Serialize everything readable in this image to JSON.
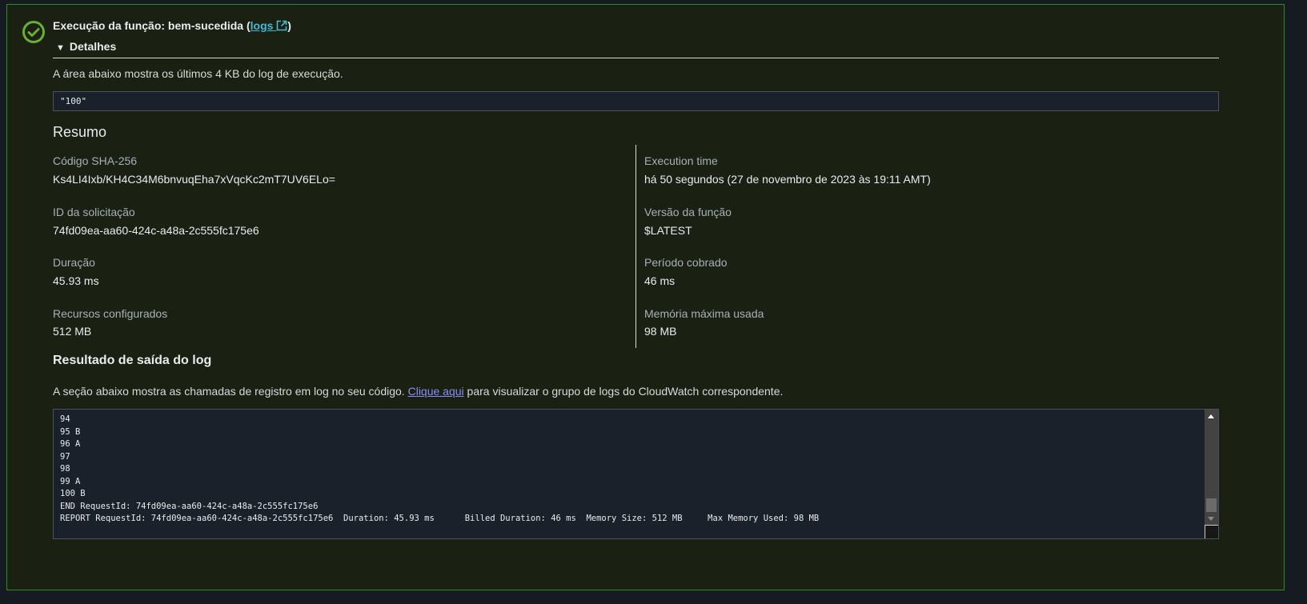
{
  "status": {
    "title_prefix": "Execução da função: bem-sucedida (",
    "logs_link": "logs",
    "title_suffix": ")",
    "color": "#6aaf35"
  },
  "details": {
    "toggle_label": "Detalhes",
    "description": "A área abaixo mostra os últimos 4 KB do log de execução.",
    "output_value": "\"100\""
  },
  "summary": {
    "heading": "Resumo",
    "left": [
      {
        "label": "Código SHA-256",
        "value": "Ks4LI4Ixb/KH4C34M6bnvuqEha7xVqcKc2mT7UV6ELo="
      },
      {
        "label": "ID da solicitação",
        "value": "74fd09ea-aa60-424c-a48a-2c555fc175e6"
      },
      {
        "label": "Duração",
        "value": "45.93 ms"
      },
      {
        "label": "Recursos configurados",
        "value": "512 MB"
      }
    ],
    "right": [
      {
        "label": "Execution time",
        "value": "há 50 segundos (27 de novembro de 2023 às 19:11 AMT)"
      },
      {
        "label": "Versão da função",
        "value": "$LATEST"
      },
      {
        "label": "Período cobrado",
        "value": "46 ms"
      },
      {
        "label": "Memória máxima usada",
        "value": "98 MB"
      }
    ]
  },
  "log_output": {
    "heading": "Resultado de saída do log",
    "desc_prefix": "A seção abaixo mostra as chamadas de registro em log no seu código. ",
    "link": "Clique aqui",
    "desc_suffix": " para visualizar o grupo de logs do CloudWatch correspondente.",
    "text": "94\n95 B\n96 A\n97\n98\n99 A\n100 B\nEND RequestId: 74fd09ea-aa60-424c-a48a-2c555fc175e6\nREPORT RequestId: 74fd09ea-aa60-424c-a48a-2c555fc175e6\tDuration: 45.93 ms\tBilled Duration: 46 ms\tMemory Size: 512 MB\tMax Memory Used: 98 MB"
  }
}
